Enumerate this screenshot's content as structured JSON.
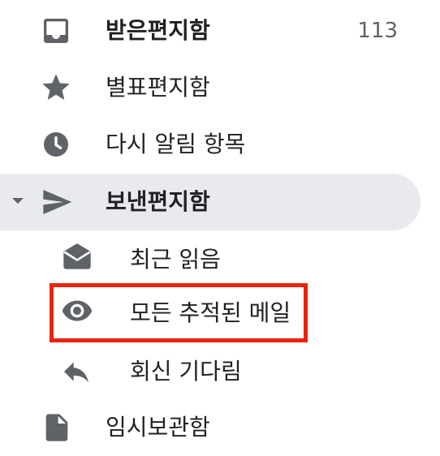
{
  "nav": {
    "items": [
      {
        "id": "inbox",
        "label": "받은편지함",
        "count": "113",
        "icon": "inbox-icon",
        "bold": true
      },
      {
        "id": "starred",
        "label": "별표편지함",
        "icon": "star-icon"
      },
      {
        "id": "snoozed",
        "label": "다시 알림 항목",
        "icon": "clock-icon"
      },
      {
        "id": "sent",
        "label": "보낸편지함",
        "icon": "send-icon",
        "bold": true,
        "selected": true,
        "expanded": true
      },
      {
        "id": "recently-read",
        "label": "최근 읽음",
        "icon": "opened-envelope-icon",
        "sub": true
      },
      {
        "id": "all-tracked",
        "label": "모든 추적된 메일",
        "icon": "eye-icon",
        "sub": true,
        "highlighted": true
      },
      {
        "id": "awaiting-reply",
        "label": "회신 기다림",
        "icon": "reply-icon",
        "sub": true
      },
      {
        "id": "drafts",
        "label": "임시보관함",
        "icon": "draft-icon"
      }
    ]
  },
  "colors": {
    "icon": "#5f6368",
    "selected_bg": "#e8eaed",
    "highlight_border": "#e8230e",
    "text": "#202124"
  }
}
